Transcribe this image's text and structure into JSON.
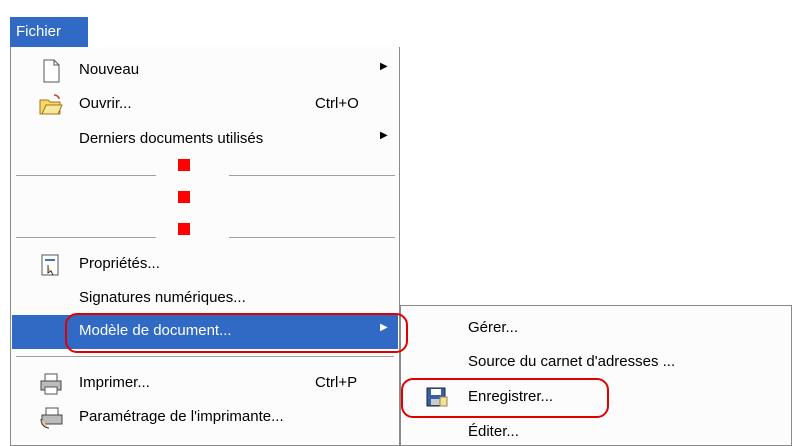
{
  "menubar": {
    "title": "Fichier"
  },
  "menu": {
    "items": [
      {
        "label": "Nouveau",
        "shortcut": "",
        "icon": "new-document-icon"
      },
      {
        "label": "Ouvrir...",
        "shortcut": "Ctrl+O",
        "icon": "open-folder-icon"
      },
      {
        "label": "Derniers documents utilisés",
        "shortcut": "",
        "icon": ""
      },
      {
        "label": "Propriétés...",
        "shortcut": "",
        "icon": "properties-icon"
      },
      {
        "label": "Signatures numériques...",
        "shortcut": "",
        "icon": ""
      },
      {
        "label": "Modèle de document...",
        "shortcut": "",
        "icon": ""
      },
      {
        "label": "Imprimer...",
        "shortcut": "Ctrl+P",
        "icon": "printer-icon"
      },
      {
        "label": "Paramétrage de l'imprimante...",
        "shortcut": "",
        "icon": "printer-settings-icon"
      }
    ]
  },
  "submenu": {
    "items": [
      {
        "label": "Gérer..."
      },
      {
        "label": "Source du carnet d'adresses ..."
      },
      {
        "label": "Enregistrer...",
        "icon": "save-disk-icon"
      },
      {
        "label": "Éditer..."
      }
    ]
  },
  "colors": {
    "highlight": "#316ac5",
    "annotation": "#e00000"
  }
}
